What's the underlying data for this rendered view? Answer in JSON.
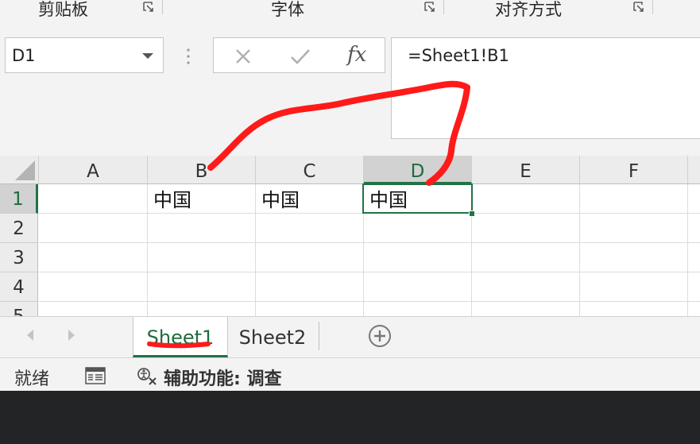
{
  "ribbon": {
    "groups": [
      {
        "label": "剪贴板"
      },
      {
        "label": "字体"
      },
      {
        "label": "对齐方式"
      }
    ]
  },
  "formula_bar": {
    "name_box": "D1",
    "cancel_icon": "x-icon",
    "enter_icon": "check-icon",
    "fx_label": "fx",
    "formula": "=Sheet1!B1"
  },
  "grid": {
    "columns": [
      "A",
      "B",
      "C",
      "D",
      "E",
      "F"
    ],
    "rows": [
      "1",
      "2",
      "3",
      "4",
      "5"
    ],
    "cells": {
      "B1": "中国",
      "C1": "中国",
      "D1": "中国"
    },
    "active_cell": "D1"
  },
  "sheets": {
    "tabs": [
      "Sheet1",
      "Sheet2"
    ],
    "active": "Sheet1"
  },
  "status_bar": {
    "ready": "就绪",
    "accessibility": "辅助功能: 调查"
  },
  "colors": {
    "excel_green": "#217346",
    "annotation_red": "#ff1a1a"
  }
}
